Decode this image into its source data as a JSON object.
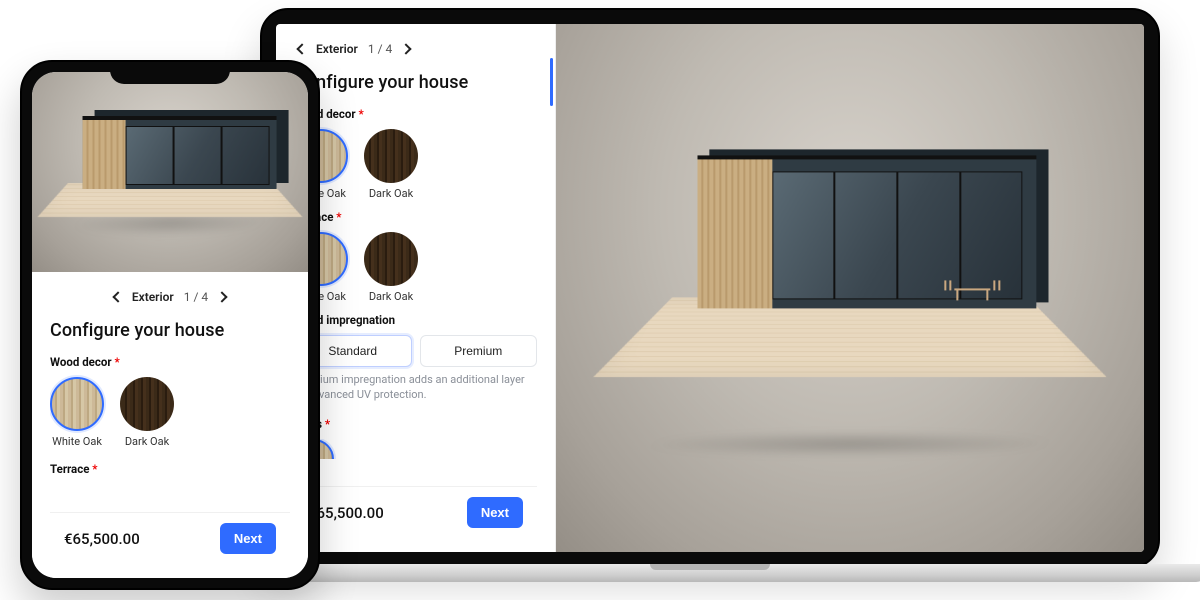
{
  "breadcrumb": {
    "label": "Exterior",
    "step": "1 / 4"
  },
  "title": "Configure your house",
  "sections": {
    "wood_decor": {
      "label": "Wood decor",
      "required": true,
      "options": [
        {
          "name": "White Oak",
          "swatch": "light",
          "selected": true
        },
        {
          "name": "Dark Oak",
          "swatch": "dark",
          "selected": false
        }
      ]
    },
    "terrace": {
      "label": "Terrace",
      "required": true,
      "options": [
        {
          "name": "White Oak",
          "swatch": "light",
          "selected": true
        },
        {
          "name": "Dark Oak",
          "swatch": "dark",
          "selected": false
        }
      ]
    },
    "wood_impregnation": {
      "label": "Wood impregnation",
      "required": false,
      "options": [
        {
          "name": "Standard",
          "selected": true
        },
        {
          "name": "Premium",
          "selected": false
        }
      ],
      "hint": "Premium impregnation adds an additional layer of advanced UV protection."
    },
    "walls": {
      "label": "Walls",
      "required": true
    }
  },
  "price": "€65,500.00",
  "next_label": "Next",
  "required_marker": "*"
}
